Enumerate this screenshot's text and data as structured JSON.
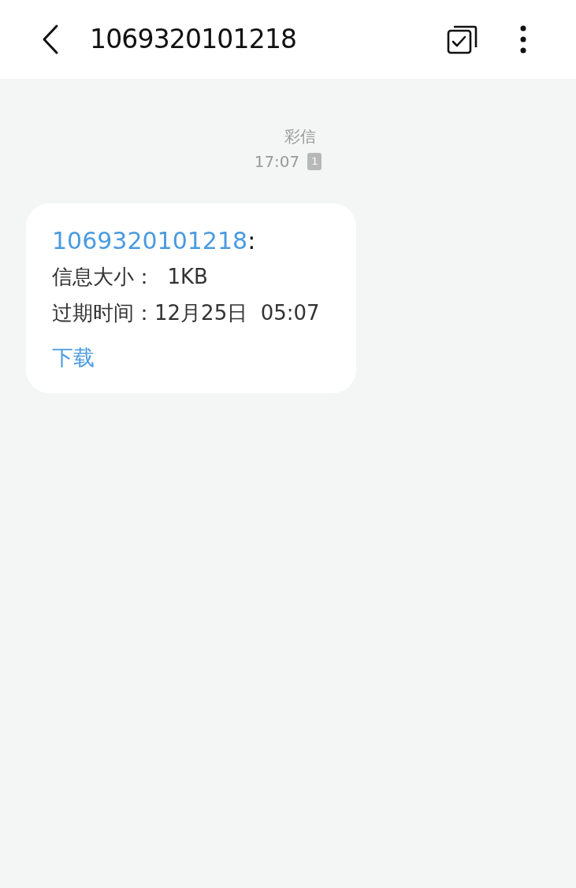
{
  "header": {
    "title": "1069320101218"
  },
  "message": {
    "type_label": "彩信",
    "time": "17:07",
    "sim": "1",
    "sender": "1069320101218",
    "sender_suffix": ":",
    "lines": [
      "信息大小：  1KB",
      "过期时间：12月25日  05:07"
    ],
    "action": "下载"
  }
}
